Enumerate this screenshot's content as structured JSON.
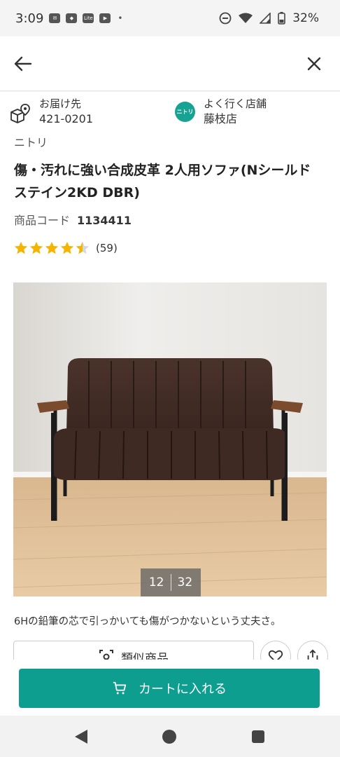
{
  "status_bar": {
    "time": "3:09",
    "notif_icons": [
      "mail-icon",
      "app-icon",
      "lite-icon",
      "youtube-icon"
    ],
    "dot": "•",
    "battery_percent": "32%"
  },
  "top_bar": {
    "back_icon": "arrow-left-icon",
    "close_icon": "close-icon"
  },
  "delivery": {
    "label": "お届け先",
    "postal_code": "421-0201"
  },
  "store": {
    "logo_text": "ニトリ",
    "label": "よく行く店舗",
    "name": "藤枝店"
  },
  "product": {
    "brand": "ニトリ",
    "title": "傷・汚れに強い合成皮革 2人用ソファ(Nシールド ステイン2KD DBR)",
    "code_label": "商品コード",
    "code_value": "1134411",
    "rating": 4.5,
    "review_count": "(59)",
    "image": {
      "current": "12",
      "total": "32"
    },
    "caption": "6Hの鉛筆の芯で引っかいても傷がつかないという丈夫さ。"
  },
  "actions": {
    "similar_label": "類似商品",
    "cart_label": "カートに入れる"
  },
  "colors": {
    "accent": "#0d9e90",
    "star": "#f5b400"
  }
}
